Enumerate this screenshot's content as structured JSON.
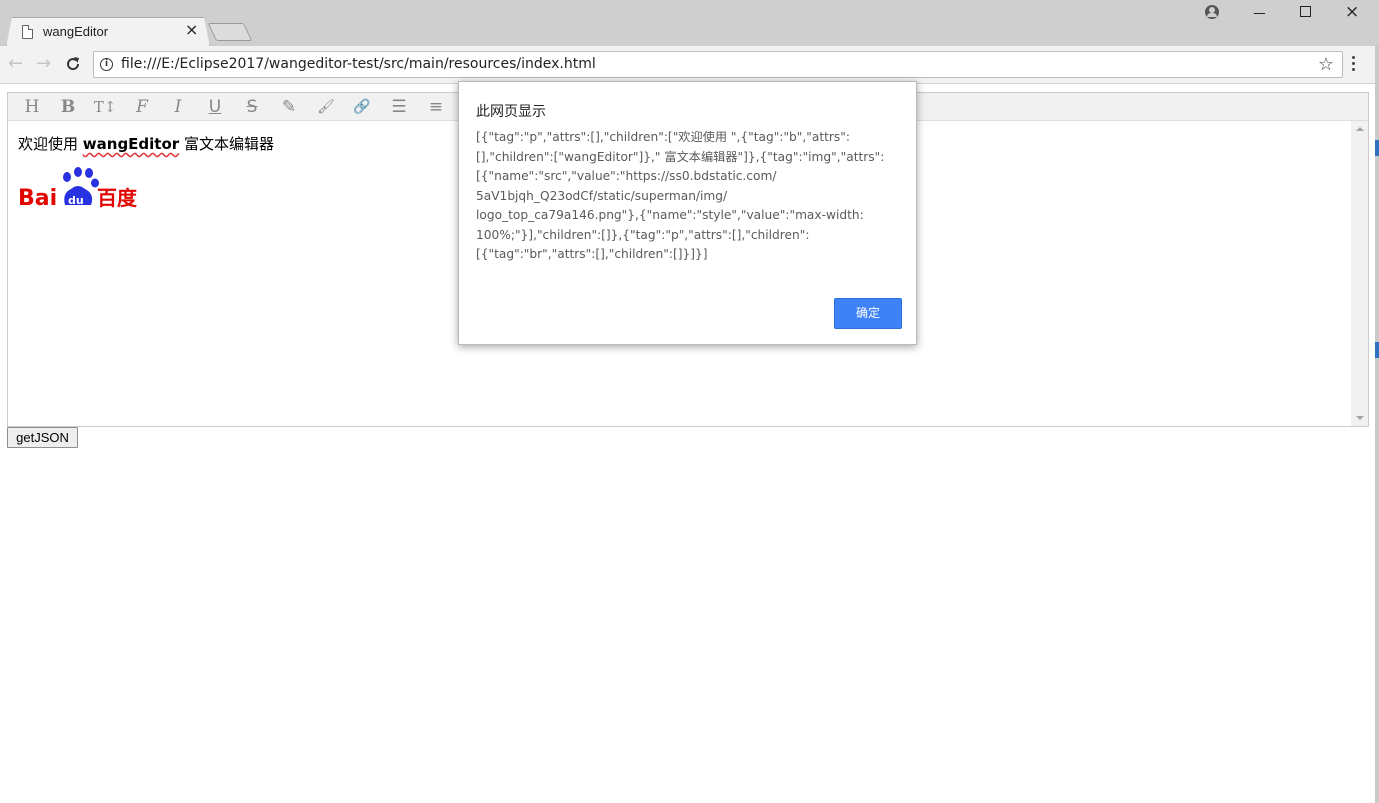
{
  "browser": {
    "tab": {
      "title": "wangEditor",
      "close_glyph": "×"
    },
    "window_controls": {
      "minimize": "minimize",
      "maximize": "maximize",
      "close": "×"
    },
    "nav": {
      "back": "←",
      "forward": "→",
      "reload": "C"
    },
    "address_bar": {
      "info_glyph": "i",
      "url": "file:///E:/Eclipse2017/wangeditor-test/src/main/resources/index.html",
      "star_glyph": "☆"
    }
  },
  "editor": {
    "toolbar": {
      "buttons": [
        {
          "icon": "heading-icon",
          "glyph": "H"
        },
        {
          "icon": "bold-icon",
          "glyph": "B"
        },
        {
          "icon": "font-size-icon",
          "glyph": "T↕"
        },
        {
          "icon": "font-family-icon",
          "glyph": "F"
        },
        {
          "icon": "italic-icon",
          "glyph": "I"
        },
        {
          "icon": "underline-icon",
          "glyph": "U"
        },
        {
          "icon": "strikethrough-icon",
          "glyph": "S"
        },
        {
          "icon": "text-color-icon",
          "glyph": "✎"
        },
        {
          "icon": "background-color-icon",
          "glyph": "🖌"
        },
        {
          "icon": "link-icon",
          "glyph": "🔗"
        },
        {
          "icon": "list-icon",
          "glyph": "☰"
        },
        {
          "icon": "justify-icon",
          "glyph": "≡"
        }
      ]
    },
    "content": {
      "text_before": "欢迎使用 ",
      "text_bold": "wangEditor",
      "text_after": " 富文本编辑器",
      "image_alt": "Baidu 百度 logo",
      "logo_text": {
        "left": "Bai",
        "right": "百度"
      }
    }
  },
  "page": {
    "getjson_button": "getJSON"
  },
  "alert": {
    "title": "此网页显示",
    "message": "[{\"tag\":\"p\",\"attrs\":[],\"children\":[\"欢迎使用 \",{\"tag\":\"b\",\"attrs\":\n[],\"children\":[\"wangEditor\"]},\" 富文本编辑器\"]},{\"tag\":\"img\",\"attrs\":\n[{\"name\":\"src\",\"value\":\"https://ss0.bdstatic.com/\n5aV1bjqh_Q23odCf/static/superman/img/\nlogo_top_ca79a146.png\"},{\"name\":\"style\",\"value\":\"max-width:\n100%;\"}],\"children\":[]},{\"tag\":\"p\",\"attrs\":[],\"children\":\n[{\"tag\":\"br\",\"attrs\":[],\"children\":[]}]}]",
    "ok_label": "确定"
  },
  "colors": {
    "accent": "#3e82f7",
    "baidu_red": "#e10602",
    "baidu_blue": "#2932e1"
  }
}
